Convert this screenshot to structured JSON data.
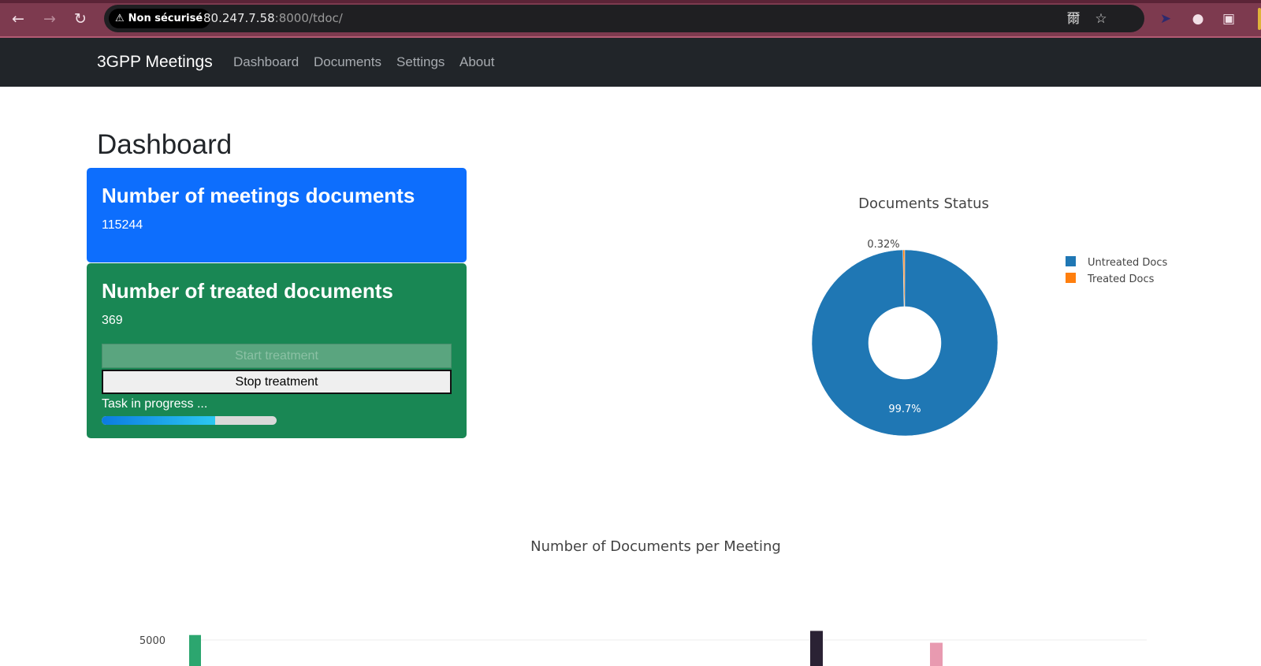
{
  "browser": {
    "back_icon": "arrow-left-icon",
    "forward_icon": "arrow-right-icon",
    "reload_icon": "reload-icon",
    "security_label": "Non sécurisé",
    "url_host": "80.247.7.58",
    "url_rest": ":8000/tdoc/",
    "translate_icon": "translate-icon",
    "bookmark_icon": "star-icon"
  },
  "navbar": {
    "brand": "3GPP Meetings",
    "links": [
      "Dashboard",
      "Documents",
      "Settings",
      "About"
    ]
  },
  "page": {
    "title": "Dashboard"
  },
  "cards": {
    "meetings": {
      "title": "Number of meetings documents",
      "value": "115244"
    },
    "treated": {
      "title": "Number of treated documents",
      "value": "369",
      "start_label": "Start treatment",
      "stop_label": "Stop treatment",
      "task_label": "Task in progress ...",
      "progress": 0.65
    }
  },
  "colors": {
    "primary_card": "#0d6efd",
    "success_card": "#198754",
    "untreated": "#1f77b4",
    "treated": "#ff7f0e"
  },
  "chart_data": [
    {
      "type": "pie",
      "title": "Documents Status",
      "hole": true,
      "labels": [
        "Untreated Docs",
        "Treated Docs"
      ],
      "values": [
        114875,
        369
      ],
      "percent_labels": [
        "99.7%",
        "0.32%"
      ],
      "legend_position": "right"
    },
    {
      "type": "bar",
      "title": "Number of Documents per Meeting",
      "ytick_labels": [
        "5000"
      ],
      "ylim": [
        0,
        5600
      ],
      "visible_bars": [
        {
          "value": 5180,
          "color": "#2ca66f"
        },
        {
          "value": 5330,
          "color": "#2a2234"
        },
        {
          "value": 4900,
          "color": "#e89ab0"
        }
      ]
    }
  ]
}
